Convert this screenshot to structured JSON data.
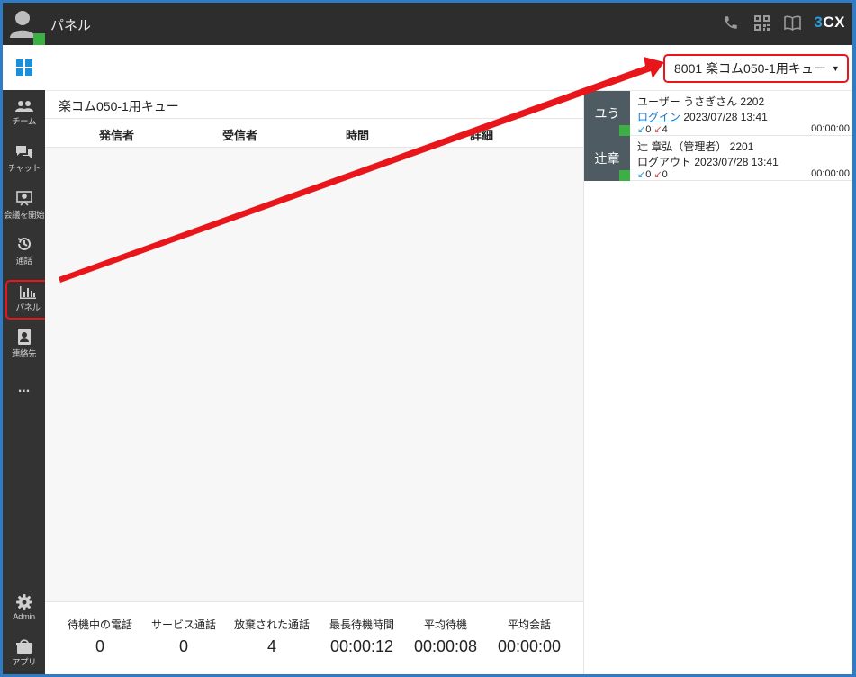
{
  "header": {
    "title": "パネル",
    "brand_prefix": "3",
    "brand_suffix": "CX",
    "icons": [
      "phone-icon",
      "qr-code-icon",
      "book-icon"
    ]
  },
  "sidebar": {
    "items": [
      {
        "label": "チーム",
        "icon": "team-icon"
      },
      {
        "label": "チャット",
        "icon": "chat-icon"
      },
      {
        "label": "会議を開始",
        "icon": "meeting-icon"
      },
      {
        "label": "通話",
        "icon": "history-icon"
      },
      {
        "label": "パネル",
        "icon": "bar-chart-icon",
        "active": true
      },
      {
        "label": "連絡先",
        "icon": "contacts-icon"
      },
      {
        "label": "...",
        "icon": "more-icon"
      },
      {
        "label": "Admin",
        "icon": "gear-icon"
      },
      {
        "label": "アプリ",
        "icon": "apps-icon"
      }
    ]
  },
  "queue_selector": {
    "value": "8001 楽コム050-1用キュー"
  },
  "panel": {
    "title": "楽コム050-1用キュー",
    "columns": [
      "発信者",
      "受信者",
      "時間",
      "詳細"
    ]
  },
  "stats": [
    {
      "label": "待機中の電話",
      "value": "0"
    },
    {
      "label": "サービス通話",
      "value": "0"
    },
    {
      "label": "放棄された通話",
      "value": "4"
    },
    {
      "label": "最長待機時間",
      "value": "00:00:12"
    },
    {
      "label": "平均待機",
      "value": "00:00:08"
    },
    {
      "label": "平均会話",
      "value": "00:00:00"
    }
  ],
  "agents": [
    {
      "tag": "ユう",
      "name": "ユーザー うさぎさん 2202",
      "status_link": "ログイン",
      "timestamp": "2023/07/28 13:41",
      "in_count": "0",
      "out_count": "4",
      "duration": "00:00:00"
    },
    {
      "tag": "辻章",
      "name": "辻 章弘（管理者） 2201",
      "status_link": "ログアウト",
      "timestamp": "2023/07/28 13:41",
      "in_count": "0",
      "out_count": "0",
      "duration": "00:00:00"
    }
  ],
  "colors": {
    "accent_red": "#e8161b",
    "presence_green": "#3cb044",
    "sidebar_bg": "#333333",
    "topbar_bg": "#2d2d2d",
    "brand_blue": "#2a9cd8",
    "frame_blue": "#2f7cc4"
  }
}
